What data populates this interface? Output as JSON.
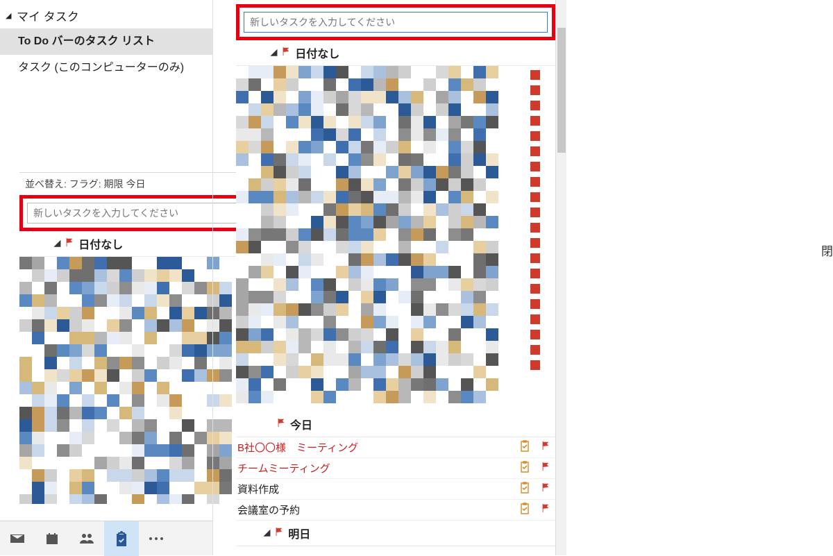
{
  "sidebar": {
    "group_label": "マイ タスク",
    "items": [
      {
        "label": "To Do バーのタスク リスト",
        "selected": true
      },
      {
        "label": "タスク (このコンピューターのみ)",
        "selected": false
      }
    ]
  },
  "popout": {
    "header_text": "並べ替え: フラグ: 期限      今日",
    "input_placeholder": "新しいタスクを入力してください",
    "group_no_date": "日付なし"
  },
  "main": {
    "input_placeholder": "新しいタスクを入力してください",
    "group_no_date": "日付なし",
    "group_today": "今日",
    "group_tomorrow": "明日",
    "today_tasks": [
      {
        "title": "B社〇〇様　ミーティング",
        "overdue": true
      },
      {
        "title": "チームミーティング",
        "overdue": true
      },
      {
        "title": "資料作成",
        "overdue": false
      },
      {
        "title": "会議室の予約",
        "overdue": false
      }
    ]
  },
  "module_bar": {
    "items": [
      "mail",
      "calendar",
      "people",
      "tasks",
      "more"
    ]
  },
  "rhs_trunc": "閉",
  "colors": {
    "highlight_red": "#e60012",
    "flag_red": "#d03b2f",
    "selection_gray": "#e1e1e1",
    "focus_blue": "#2d7dd2"
  }
}
